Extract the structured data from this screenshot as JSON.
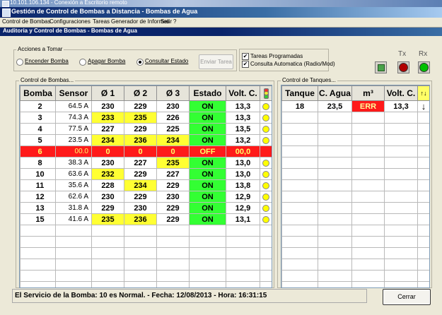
{
  "remote_title": "10.101.106.134 - Conexión a Escritorio remoto",
  "app_title": "Gestión de Control de Bombas a Distancia - Bombas de Agua",
  "menu": [
    "Control de Bombas",
    "Configuraciones",
    "Tareas",
    "Generador de Informes",
    "Salir",
    "?"
  ],
  "child_title": "Auditoria y Control de Bombas - Bombas de Agua",
  "acciones": {
    "legend": "Acciones a Tomar",
    "options": [
      "Encender Bomba",
      "Apagar Bomba",
      "Consultar Estado"
    ],
    "selected": "Consultar Estado",
    "send_button": "Enviar Tarea"
  },
  "checks": {
    "tareas": "Tareas Programadas",
    "consulta": "Consulta Automatica (Radio/Mod)",
    "tareas_checked": true,
    "consulta_checked": true
  },
  "indicators": {
    "tx_label": "Tx",
    "rx_label": "Rx",
    "tx_color": "#b00000",
    "rx_color": "#00c000"
  },
  "bombas": {
    "legend": "Control de Bombas...",
    "headers": [
      "Bomba",
      "Sensor",
      "Ø 1",
      "Ø 2",
      "Ø 3",
      "Estado",
      "Volt. C."
    ],
    "rows": [
      {
        "bomba": "2",
        "sensor": "64.5 A",
        "f1": "230",
        "f2": "229",
        "f3": "230",
        "estado": "ON",
        "volt": "13,3",
        "hl": []
      },
      {
        "bomba": "3",
        "sensor": "74.3 A",
        "f1": "233",
        "f2": "235",
        "f3": "226",
        "estado": "ON",
        "volt": "13,3",
        "hl": [
          "f1",
          "f2"
        ]
      },
      {
        "bomba": "4",
        "sensor": "77.5 A",
        "f1": "227",
        "f2": "229",
        "f3": "225",
        "estado": "ON",
        "volt": "13,5",
        "hl": []
      },
      {
        "bomba": "5",
        "sensor": "23.5 A",
        "f1": "234",
        "f2": "236",
        "f3": "234",
        "estado": "ON",
        "volt": "13,2",
        "hl": [
          "f1",
          "f2",
          "f3"
        ]
      },
      {
        "bomba": "6",
        "sensor": "00.0",
        "f1": "0",
        "f2": "0",
        "f3": "0",
        "estado": "OFF",
        "volt": "00,0",
        "hl": [],
        "alarm": true
      },
      {
        "bomba": "8",
        "sensor": "38.3 A",
        "f1": "230",
        "f2": "227",
        "f3": "235",
        "estado": "ON",
        "volt": "13,0",
        "hl": [
          "f3"
        ]
      },
      {
        "bomba": "10",
        "sensor": "63.6 A",
        "f1": "232",
        "f2": "229",
        "f3": "227",
        "estado": "ON",
        "volt": "13,0",
        "hl": [
          "f1"
        ]
      },
      {
        "bomba": "11",
        "sensor": "35.6 A",
        "f1": "228",
        "f2": "234",
        "f3": "229",
        "estado": "ON",
        "volt": "13,8",
        "hl": [
          "f2"
        ]
      },
      {
        "bomba": "12",
        "sensor": "62.6 A",
        "f1": "230",
        "f2": "229",
        "f3": "230",
        "estado": "ON",
        "volt": "12,9",
        "hl": []
      },
      {
        "bomba": "13",
        "sensor": "31.8 A",
        "f1": "229",
        "f2": "230",
        "f3": "229",
        "estado": "ON",
        "volt": "12,9",
        "hl": []
      },
      {
        "bomba": "15",
        "sensor": "41.6 A",
        "f1": "235",
        "f2": "236",
        "f3": "229",
        "estado": "ON",
        "volt": "13,1",
        "hl": [
          "f1",
          "f2"
        ]
      }
    ]
  },
  "tanques": {
    "legend": "Control de Tanques...",
    "headers": [
      "Tanque",
      "C. Agua",
      "m³",
      "Volt. C."
    ],
    "sort_icon": "↑↓",
    "rows": [
      {
        "tanque": "18",
        "agua": "23,5",
        "m3": "ERR",
        "volt": "13,3",
        "arrow": "down-arrow"
      }
    ]
  },
  "status_text": "El Servicio de la Bomba: 10 es Normal. - Fecha: 12/08/2013 - Hora: 16:31:15",
  "close_button": "Cerrar"
}
